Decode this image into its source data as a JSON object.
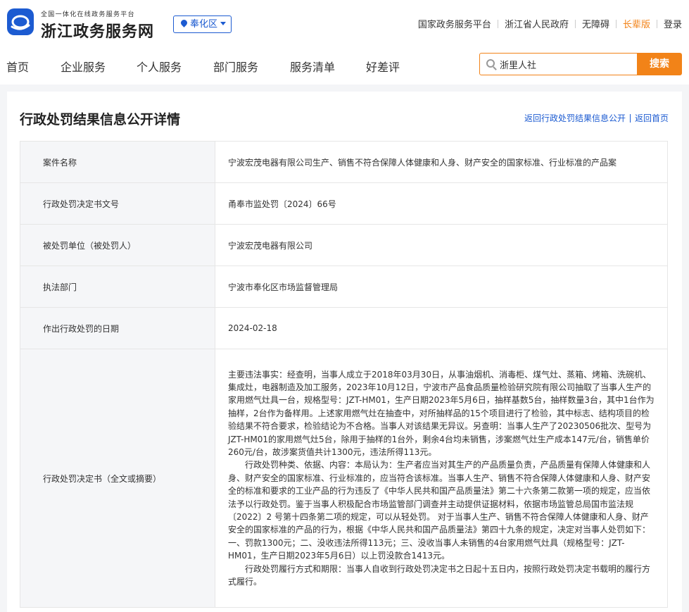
{
  "header": {
    "logo_subtitle": "全国一体化在线政务服务平台",
    "logo_title": "浙江政务服务网",
    "region": "奉化区",
    "top_links": [
      "国家政务服务平台",
      "浙江省人民政府",
      "无障碍",
      "长辈版",
      "登录"
    ],
    "accent_color": "#f28318",
    "brand_color": "#1c5bd1"
  },
  "nav": {
    "items": [
      "首页",
      "企业服务",
      "个人服务",
      "部门服务",
      "服务清单",
      "好差评"
    ]
  },
  "search": {
    "value": "浙里人社",
    "button_label": "搜索"
  },
  "detail": {
    "page_title": "行政处罚结果信息公开详情",
    "back_list_link": "返回行政处罚结果信息公开",
    "back_home_link": "返回首页",
    "rows": [
      {
        "label": "案件名称",
        "value": "宁波宏茂电器有限公司生产、销售不符合保障人体健康和人身、财产安全的国家标准、行业标准的产品案"
      },
      {
        "label": "行政处罚决定书文号",
        "value": "甬奉市监处罚〔2024〕66号"
      },
      {
        "label": "被处罚单位（被处罚人）",
        "value": "宁波宏茂电器有限公司"
      },
      {
        "label": "执法部门",
        "value": "宁波市奉化区市场监督管理局"
      },
      {
        "label": "作出行政处罚的日期",
        "value": "2024-02-18"
      },
      {
        "label": "行政处罚决定书（全文或摘要）"
      }
    ],
    "decision_paragraphs": [
      "主要违法事实：经查明，当事人成立于2018年03月30日，从事油烟机、消毒柜、煤气灶、蒸箱、烤箱、洗碗机、集成灶，电器制造及加工服务，2023年10月12日，宁波市产品食品质量检验研究院有限公司抽取了当事人生产的家用燃气灶具一台，规格型号：JZT-HM01，生产日期2023年5月6日，抽样基数5台，抽样数量3台，其中1台作为抽样，2台作为备样用。上述家用燃气灶在抽查中，对所抽样品的15个项目进行了检验，其中标志、结构项目的检验结果不符合要求，检验结论为不合格。当事人对该结果无异议。另查明：当事人生产了20230506批次、型号为JZT-HM01的家用燃气灶5台，除用于抽样的1台外，剩余4台均未销售，涉案燃气灶生产成本147元/台，销售单价260元/台，故涉案货值共计1300元，违法所得113元。",
      "行政处罚种类、依据、内容：本局认为：生产者应当对其生产的产品质量负责，产品质量有保障人体健康和人身、财产安全的国家标准、行业标准的，应当符合该标准。当事人生产、销售不符合保障人体健康和人身、财产安全的标准和要求的工业产品的行为违反了《中华人民共和国产品质量法》第二十六条第二款第一项的规定，应当依法予以行政处罚。鉴于当事人积极配合市场监管部门调查并主动提供证据材料，依据市场监管总局国市监法规〔2022〕2 号第十四条第二项的规定，可以从轻处罚。  对于当事人生产、销售不符合保障人体健康和人身、财产安全的国家标准的产品的行为，根据《中华人民共和国产品质量法》第四十九条的规定，决定对当事人处罚如下：一、罚款1300元；二、没收违法所得113元；三、没收当事人未销售的4台家用燃气灶具（规格型号：JZT-HM01，生产日期2023年5月6日）以上罚没款合1413元。",
      "行政处罚履行方式和期限：当事人自收到行政处罚决定书之日起十五日内，按照行政处罚决定书载明的履行方式履行。"
    ]
  }
}
